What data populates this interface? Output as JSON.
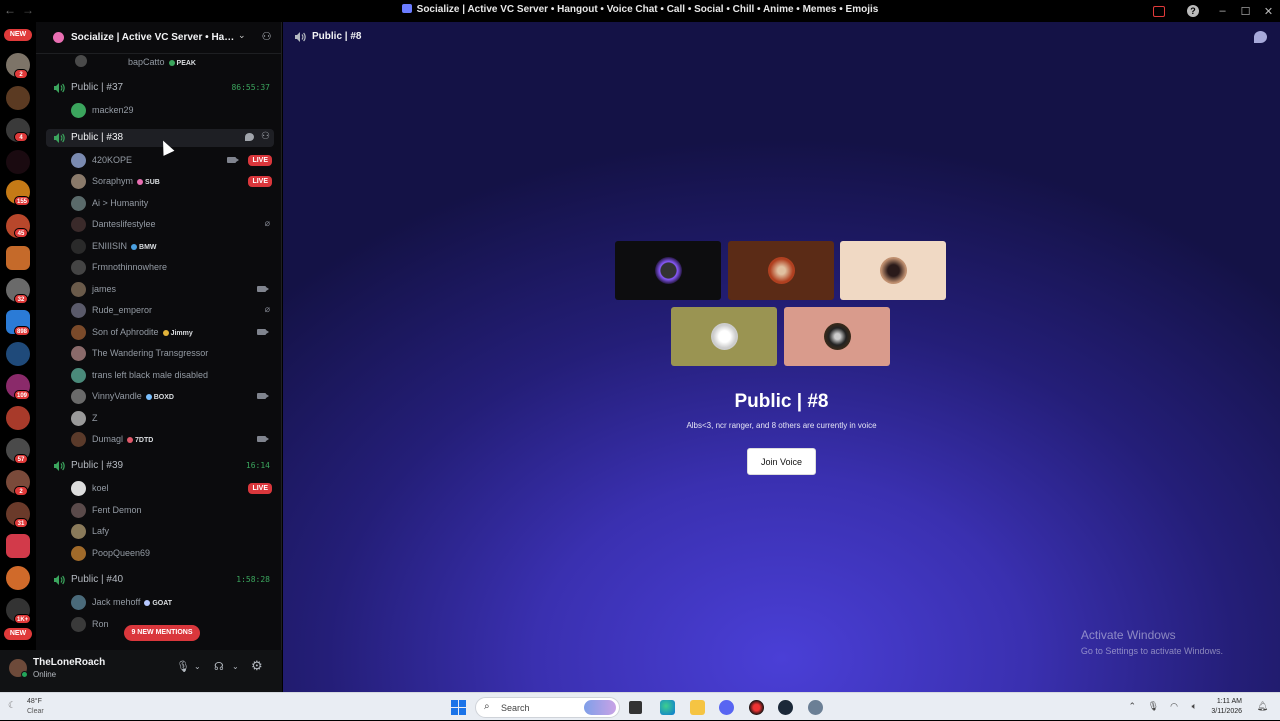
{
  "window": {
    "title": "Socialize | Active VC Server • Hangout • Voice Chat • Call • Social • Chill • Anime • Memes • Emojis"
  },
  "rail": {
    "new_top": "NEW",
    "new_bottom": "NEW",
    "badges": [
      "2",
      "4",
      "155",
      "45",
      "32",
      "898",
      "109",
      "57",
      "2",
      "31",
      "1K+"
    ]
  },
  "guild": {
    "name": "Socialize | Active VC Server • Han...",
    "peak_user": "bapCatto",
    "peak_tag": "PEAK"
  },
  "channels": {
    "c37": {
      "name": "Public | #37",
      "timer": "86:55:37",
      "users": [
        {
          "name": "macken29"
        }
      ]
    },
    "c38": {
      "name": "Public | #38",
      "users": [
        {
          "name": "420KOPE",
          "live": "LIVE"
        },
        {
          "name": "Soraphym",
          "tag": "SUB",
          "live": "LIVE"
        },
        {
          "name": "Ai > Humanity"
        },
        {
          "name": "Danteslifestylee"
        },
        {
          "name": "ENIIISIN",
          "tag": "BMW"
        },
        {
          "name": "Frmnothinnowhere"
        },
        {
          "name": "james"
        },
        {
          "name": "Rude_emperor"
        },
        {
          "name": "Son of Aphrodite",
          "tag": "Jimmy"
        },
        {
          "name": "The Wandering Transgressor"
        },
        {
          "name": "trans left black male disabled"
        },
        {
          "name": "VinnyVandle",
          "tag": "BOXD"
        },
        {
          "name": "Z"
        },
        {
          "name": "Dumagl",
          "tag": "7DTD"
        }
      ]
    },
    "c39": {
      "name": "Public | #39",
      "timer": "16:14",
      "users": [
        {
          "name": "koel",
          "live": "LIVE"
        },
        {
          "name": "Fent Demon"
        },
        {
          "name": "Lafy"
        },
        {
          "name": "PoopQueen69"
        }
      ]
    },
    "c40": {
      "name": "Public | #40",
      "timer": "1:58:28",
      "users": [
        {
          "name": "Jack mehoff",
          "tag": "GOAT"
        },
        {
          "name": "Ron"
        }
      ]
    }
  },
  "mentions": "9 NEW MENTIONS",
  "user_panel": {
    "name": "TheLoneRoach",
    "status": "Online"
  },
  "stage": {
    "header_title": "Public | #8",
    "title": "Public | #8",
    "subtitle": "Albs<3, ncr ranger, and 8 others are currently in voice",
    "join_label": "Join Voice",
    "tile_colors": [
      "#0d0d0f",
      "#5b2b16",
      "#f0d9c4",
      "#9a9452",
      "#d99b8c"
    ]
  },
  "watermark": {
    "line1": "Activate Windows",
    "line2": "Go to Settings to activate Windows."
  },
  "taskbar": {
    "temp": "48°F",
    "condition": "Clear",
    "search_placeholder": "Search",
    "time": "1:11 AM",
    "date": "3/11/2026"
  }
}
